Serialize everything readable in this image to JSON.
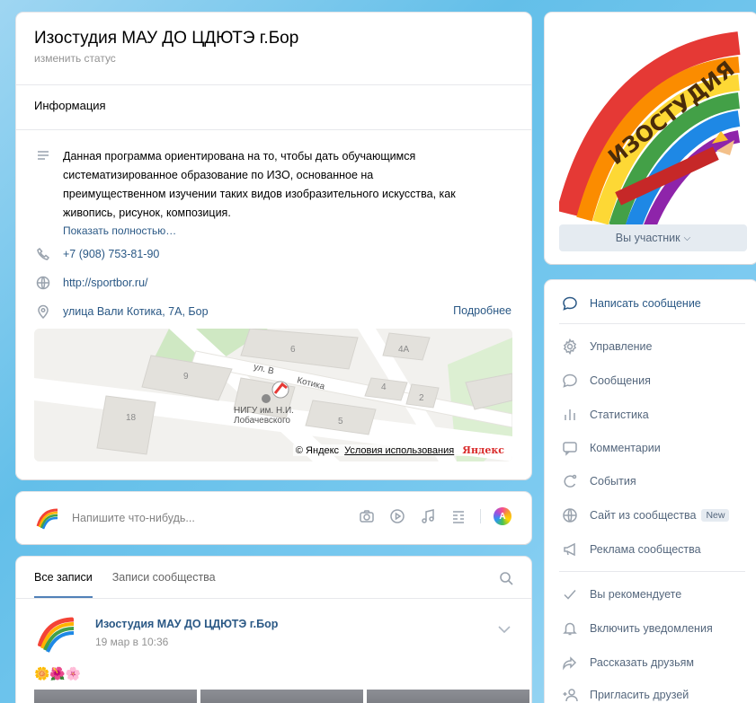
{
  "group": {
    "title": "Изостудия МАУ ДО ЦДЮТЭ г.Бор",
    "status_link": "изменить статус",
    "info_label": "Информация",
    "description": "Данная программа ориентирована на то, чтобы дать обучающимся систематизированное образование по ИЗО, основанное на преимущественном изучении таких видов изобразительного искусства, как живопись, рисунок, композиция.",
    "show_more": "Показать полностью…",
    "phone": "+7 (908) 753-81-90",
    "website": "http://sportbor.ru/",
    "address": "улица Вали Котика, 7А, Бор",
    "details_link": "Подробнее"
  },
  "map": {
    "street_label": "ул. Вали Котика",
    "street_left": "ул. В",
    "street_right": "Котика",
    "poi_label_1": "НИГУ им. Н.И.",
    "poi_label_2": "Лобачевского",
    "buildings": [
      "9",
      "6",
      "4А",
      "4",
      "2",
      "18",
      "5"
    ],
    "credit_prefix": "© Яндекс",
    "credit_terms": "Условия использования",
    "logo_text": "Яндекс"
  },
  "composer": {
    "placeholder": "Напишите что-нибудь..."
  },
  "feed": {
    "tabs": [
      {
        "label": "Все записи"
      },
      {
        "label": "Записи сообщества"
      }
    ],
    "post": {
      "author": "Изостудия МАУ ДО ЦДЮТЭ г.Бор",
      "date": "19 мар в 10:36",
      "emoji": "🌼🌺🌸"
    }
  },
  "cover": {
    "logo_text": "ИЗОСТУДИЯ",
    "member_button": "Вы участник"
  },
  "actions": [
    {
      "label": "Написать сообщение",
      "icon": "message-bubble-icon"
    },
    {
      "label": "Управление",
      "icon": "gear-icon"
    },
    {
      "label": "Сообщения",
      "icon": "chat-icon"
    },
    {
      "label": "Статистика",
      "icon": "statistics-icon"
    },
    {
      "label": "Комментарии",
      "icon": "comment-icon"
    },
    {
      "label": "События",
      "icon": "events-icon"
    },
    {
      "label": "Сайт из сообщества",
      "icon": "globe-icon",
      "badge": "New"
    },
    {
      "label": "Реклама сообщества",
      "icon": "megaphone-icon"
    },
    {
      "label": "Вы рекомендуете",
      "icon": "check-icon"
    },
    {
      "label": "Включить уведомления",
      "icon": "bell-icon"
    },
    {
      "label": "Рассказать друзьям",
      "icon": "share-icon"
    },
    {
      "label": "Пригласить друзей",
      "icon": "invite-icon"
    }
  ],
  "colors": {
    "link": "#2a5885",
    "muted": "#939393",
    "icon": "#99a2ad",
    "button_bg": "#e5ebf1"
  }
}
